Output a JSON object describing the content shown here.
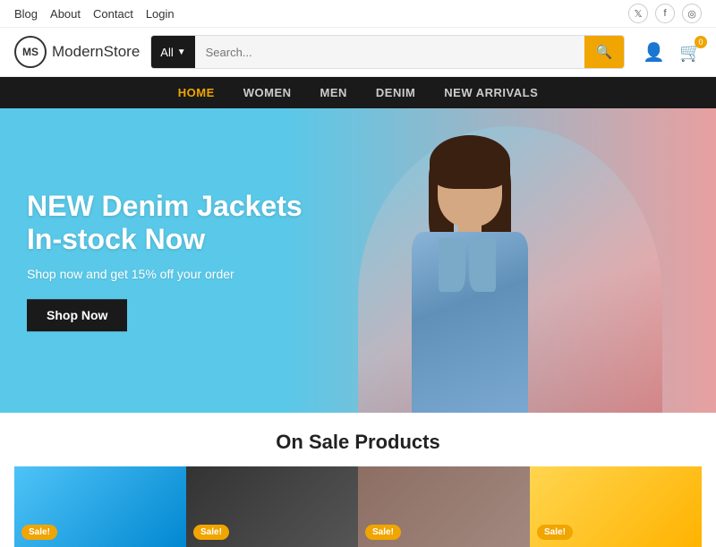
{
  "topbar": {
    "links": [
      {
        "label": "Blog",
        "id": "blog"
      },
      {
        "label": "About",
        "id": "about"
      },
      {
        "label": "Contact",
        "id": "contact"
      },
      {
        "label": "Login",
        "id": "login"
      }
    ],
    "social": [
      {
        "icon": "𝕏",
        "name": "twitter"
      },
      {
        "icon": "f",
        "name": "facebook"
      },
      {
        "icon": "◎",
        "name": "instagram"
      }
    ]
  },
  "header": {
    "logo_initials": "MS",
    "logo_name_bold": "Modern",
    "logo_name_light": "Store",
    "search_category": "All",
    "search_placeholder": "Search...",
    "search_btn_icon": "🔍",
    "cart_count": "0"
  },
  "nav": {
    "items": [
      {
        "label": "HOME",
        "active": true
      },
      {
        "label": "WOMEN",
        "active": false
      },
      {
        "label": "MEN",
        "active": false
      },
      {
        "label": "DENIM",
        "active": false
      },
      {
        "label": "NEW ARRIVALS",
        "active": false
      }
    ]
  },
  "hero": {
    "title": "NEW Denim Jackets In-stock Now",
    "subtitle": "Shop now and get 15% off your order",
    "btn_label": "Shop Now"
  },
  "on_sale": {
    "title": "On Sale Products",
    "badges": [
      "Sale!",
      "Sale!",
      "Sale!",
      "Sale!"
    ]
  }
}
